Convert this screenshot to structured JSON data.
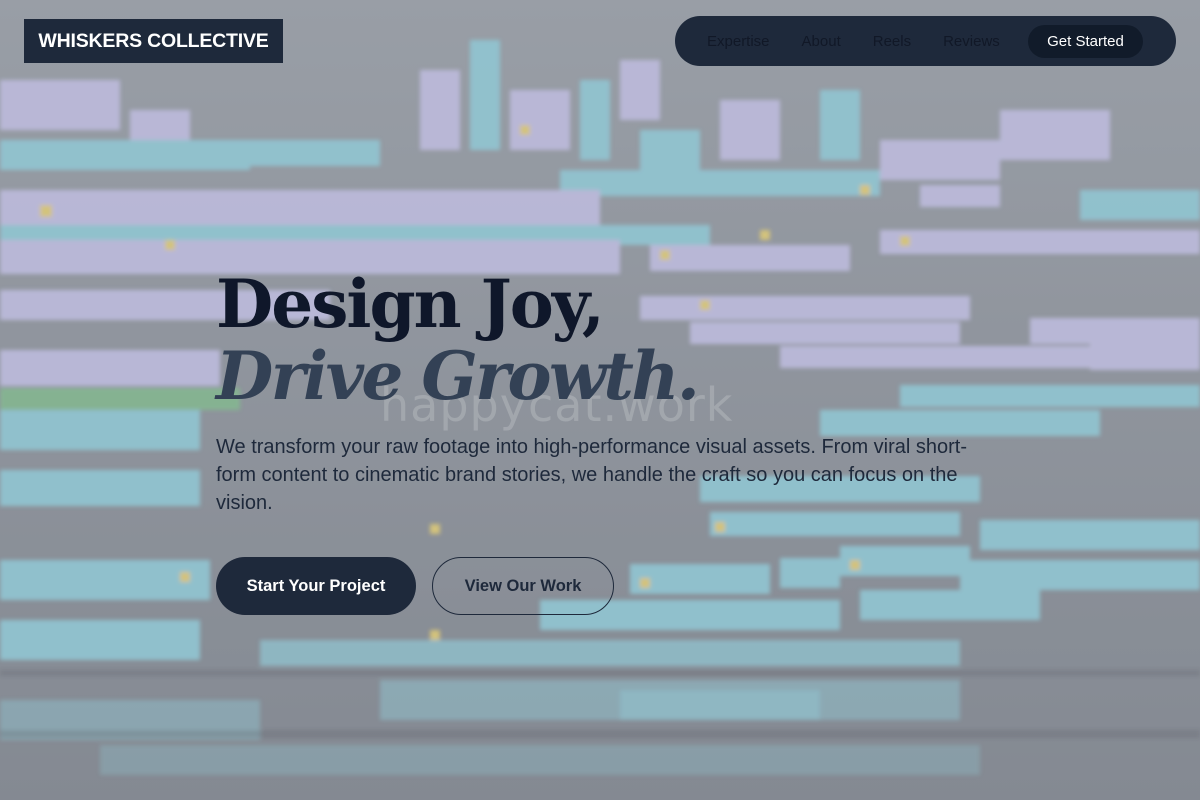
{
  "brand": {
    "name": "WHISKERS COLLECTIVE"
  },
  "nav": {
    "links": [
      "Expertise",
      "About",
      "Reels",
      "Reviews"
    ],
    "cta": "Get Started"
  },
  "hero": {
    "headline_line1": "Design Joy,",
    "headline_line2": "Drive Growth.",
    "watermark": "happycat.work",
    "description": "We transform your raw footage into high-performance visual assets. From viral short-form content to cinematic brand stories, we handle the craft so you can focus on the vision.",
    "primary_button": "Start Your Project",
    "secondary_button": "View Our Work"
  },
  "colors": {
    "dark": "#1e293b",
    "headline": "#0f172a",
    "headline_accent": "#334155",
    "clip_cyan": "#8fd3e0",
    "clip_lavender": "#c9c6ee"
  }
}
